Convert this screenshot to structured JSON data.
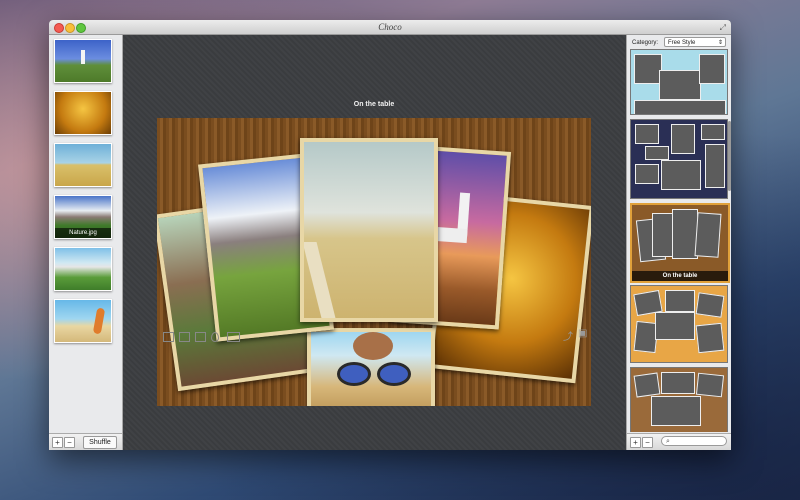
{
  "window": {
    "title": "Choco"
  },
  "left_panel": {
    "thumbnails": [
      {
        "name": "lighthouse"
      },
      {
        "name": "golden-field"
      },
      {
        "name": "road-field"
      },
      {
        "name": "mountains",
        "caption": "Nature.jpg"
      },
      {
        "name": "house"
      },
      {
        "name": "beach"
      }
    ],
    "add_label": "+",
    "remove_label": "−",
    "shuffle_label": "Shuffle"
  },
  "editor": {
    "collage_title": "On the table",
    "toolbar_icons": [
      "resize-icon",
      "page-icon",
      "layout-icon",
      "drop-icon",
      "frame-icon"
    ],
    "right_icons": [
      "share-icon",
      "export-image-icon"
    ]
  },
  "right_panel": {
    "category_label": "Category:",
    "category_value": "Free Style",
    "selected_layout_caption": "On the table",
    "add_label": "+",
    "remove_label": "−",
    "search_placeholder": ""
  },
  "colors": {
    "wood": "#7a4d1f",
    "frame": "#e8d7a6",
    "selection": "#e0a13a"
  }
}
